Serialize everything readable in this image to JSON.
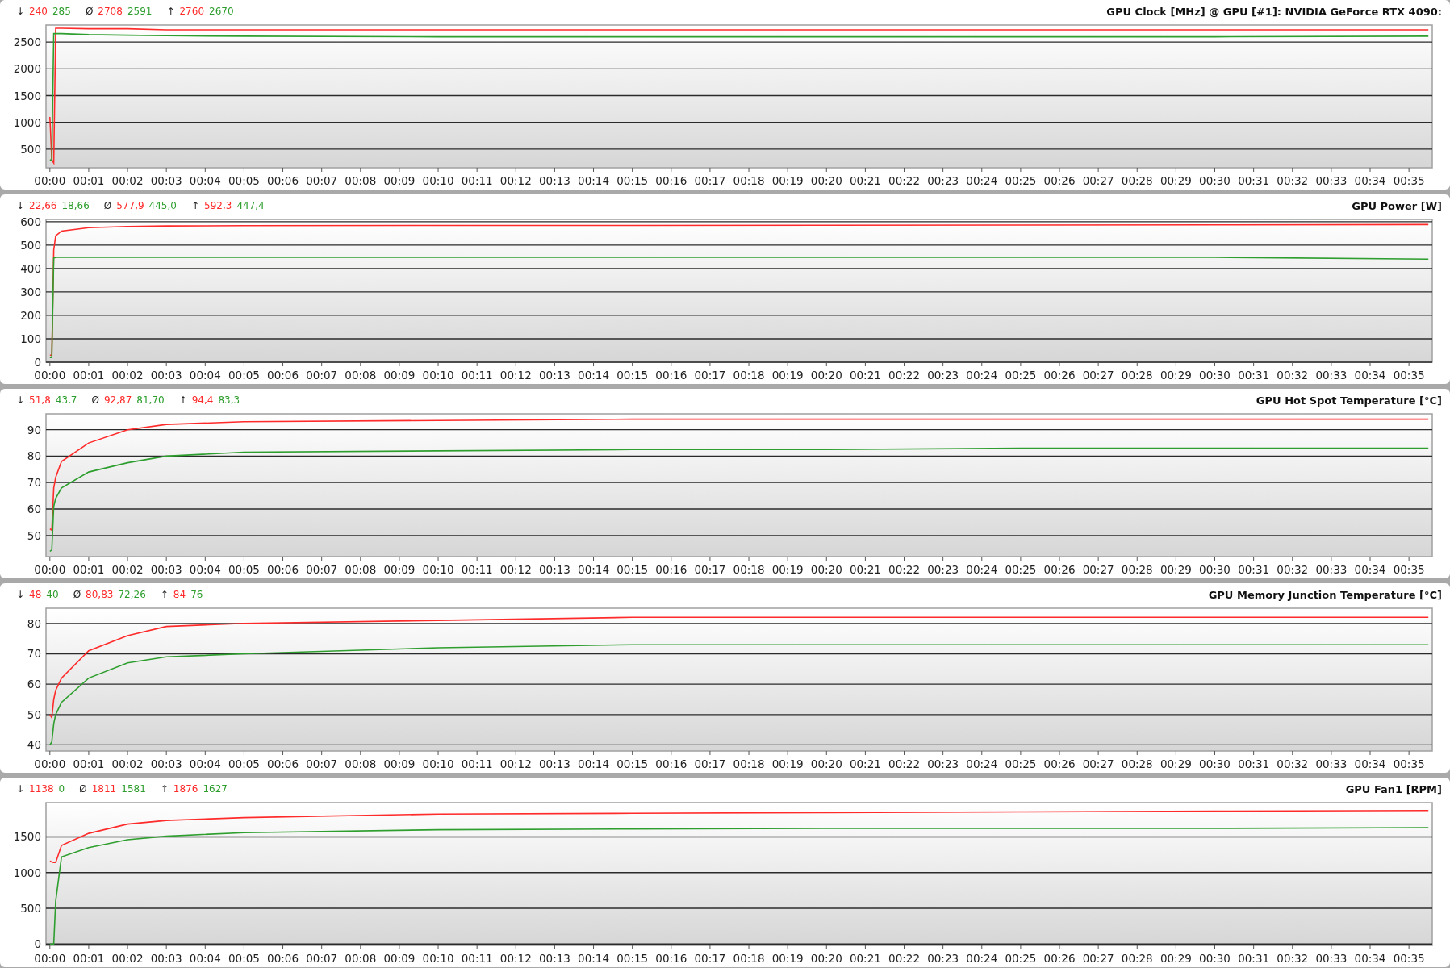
{
  "panels": [
    {
      "title": "GPU Clock [MHz] @ GPU [#1]: NVIDIA GeForce RTX 4090:",
      "stats": [
        {
          "symbol": "↓",
          "values": [
            "240",
            "285"
          ]
        },
        {
          "symbol": "Ø",
          "values": [
            "2708",
            "2591"
          ]
        },
        {
          "symbol": "↑",
          "values": [
            "2760",
            "2670"
          ]
        }
      ],
      "chart_data": {
        "type": "line",
        "x": [
          0,
          0.05,
          0.1,
          0.15,
          0.3,
          1,
          2,
          3,
          5,
          10,
          15,
          20,
          25,
          30,
          35.5
        ],
        "series": [
          {
            "color": "#ff2a2a",
            "values": [
              1100,
              300,
              240,
              2760,
              2760,
              2750,
              2750,
              2730,
              2730,
              2730,
              2730,
              2730,
              2730,
              2730,
              2730
            ]
          },
          {
            "color": "#2e9e2e",
            "values": [
              300,
              290,
              2660,
              2660,
              2660,
              2640,
              2630,
              2620,
              2610,
              2600,
              2600,
              2600,
              2600,
              2600,
              2610
            ]
          }
        ],
        "grid": true,
        "xlim": [
          -0.1,
          35.6
        ],
        "ylim": [
          150,
          2820
        ],
        "yticks": [
          500,
          1000,
          1500,
          2000,
          2500
        ],
        "xticks": [
          {
            "value": 0,
            "label": "00:00"
          },
          {
            "value": 1,
            "label": "00:01"
          },
          {
            "value": 2,
            "label": "00:02"
          },
          {
            "value": 3,
            "label": "00:03"
          },
          {
            "value": 4,
            "label": "00:04"
          },
          {
            "value": 5,
            "label": "00:05"
          },
          {
            "value": 6,
            "label": "00:06"
          },
          {
            "value": 7,
            "label": "00:07"
          },
          {
            "value": 8,
            "label": "00:08"
          },
          {
            "value": 9,
            "label": "00:09"
          },
          {
            "value": 10,
            "label": "00:10"
          },
          {
            "value": 11,
            "label": "00:11"
          },
          {
            "value": 12,
            "label": "00:12"
          },
          {
            "value": 13,
            "label": "00:13"
          },
          {
            "value": 14,
            "label": "00:14"
          },
          {
            "value": 15,
            "label": "00:15"
          },
          {
            "value": 16,
            "label": "00:16"
          },
          {
            "value": 17,
            "label": "00:17"
          },
          {
            "value": 18,
            "label": "00:18"
          },
          {
            "value": 19,
            "label": "00:19"
          },
          {
            "value": 20,
            "label": "00:20"
          },
          {
            "value": 21,
            "label": "00:21"
          },
          {
            "value": 22,
            "label": "00:22"
          },
          {
            "value": 23,
            "label": "00:23"
          },
          {
            "value": 24,
            "label": "00:24"
          },
          {
            "value": 25,
            "label": "00:25"
          },
          {
            "value": 26,
            "label": "00:26"
          },
          {
            "value": 27,
            "label": "00:27"
          },
          {
            "value": 28,
            "label": "00:28"
          },
          {
            "value": 29,
            "label": "00:29"
          },
          {
            "value": 30,
            "label": "00:30"
          },
          {
            "value": 31,
            "label": "00:31"
          },
          {
            "value": 32,
            "label": "00:32"
          },
          {
            "value": 33,
            "label": "00:33"
          },
          {
            "value": 34,
            "label": "00:34"
          },
          {
            "value": 35,
            "label": "00:35"
          }
        ]
      }
    },
    {
      "title": "GPU Power [W]",
      "stats": [
        {
          "symbol": "↓",
          "values": [
            "22,66",
            "18,66"
          ]
        },
        {
          "symbol": "Ø",
          "values": [
            "577,9",
            "445,0"
          ]
        },
        {
          "symbol": "↑",
          "values": [
            "592,3",
            "447,4"
          ]
        }
      ],
      "chart_data": {
        "type": "line",
        "x": [
          0,
          0.05,
          0.1,
          0.15,
          0.3,
          1,
          2,
          3,
          5,
          10,
          15,
          20,
          25,
          30,
          35.5
        ],
        "series": [
          {
            "color": "#ff2a2a",
            "values": [
              30,
              30,
              480,
              540,
              560,
              575,
              580,
              582,
              583,
              584,
              584,
              585,
              586,
              587,
              588
            ]
          },
          {
            "color": "#2e9e2e",
            "values": [
              20,
              20,
              445,
              448,
              448,
              448,
              448,
              448,
              448,
              448,
              448,
              448,
              448,
              448,
              440
            ]
          }
        ],
        "grid": true,
        "xlim": [
          -0.1,
          35.6
        ],
        "ylim": [
          0,
          610
        ],
        "yticks": [
          0,
          100,
          200,
          300,
          400,
          500,
          600
        ],
        "xticks": [
          {
            "value": 0,
            "label": "00:00"
          },
          {
            "value": 1,
            "label": "00:01"
          },
          {
            "value": 2,
            "label": "00:02"
          },
          {
            "value": 3,
            "label": "00:03"
          },
          {
            "value": 4,
            "label": "00:04"
          },
          {
            "value": 5,
            "label": "00:05"
          },
          {
            "value": 6,
            "label": "00:06"
          },
          {
            "value": 7,
            "label": "00:07"
          },
          {
            "value": 8,
            "label": "00:08"
          },
          {
            "value": 9,
            "label": "00:09"
          },
          {
            "value": 10,
            "label": "00:10"
          },
          {
            "value": 11,
            "label": "00:11"
          },
          {
            "value": 12,
            "label": "00:12"
          },
          {
            "value": 13,
            "label": "00:13"
          },
          {
            "value": 14,
            "label": "00:14"
          },
          {
            "value": 15,
            "label": "00:15"
          },
          {
            "value": 16,
            "label": "00:16"
          },
          {
            "value": 17,
            "label": "00:17"
          },
          {
            "value": 18,
            "label": "00:18"
          },
          {
            "value": 19,
            "label": "00:19"
          },
          {
            "value": 20,
            "label": "00:20"
          },
          {
            "value": 21,
            "label": "00:21"
          },
          {
            "value": 22,
            "label": "00:22"
          },
          {
            "value": 23,
            "label": "00:23"
          },
          {
            "value": 24,
            "label": "00:24"
          },
          {
            "value": 25,
            "label": "00:25"
          },
          {
            "value": 26,
            "label": "00:26"
          },
          {
            "value": 27,
            "label": "00:27"
          },
          {
            "value": 28,
            "label": "00:28"
          },
          {
            "value": 29,
            "label": "00:29"
          },
          {
            "value": 30,
            "label": "00:30"
          },
          {
            "value": 31,
            "label": "00:31"
          },
          {
            "value": 32,
            "label": "00:32"
          },
          {
            "value": 33,
            "label": "00:33"
          },
          {
            "value": 34,
            "label": "00:34"
          },
          {
            "value": 35,
            "label": "00:35"
          }
        ]
      }
    },
    {
      "title": "GPU Hot Spot Temperature [°C]",
      "stats": [
        {
          "symbol": "↓",
          "values": [
            "51,8",
            "43,7"
          ]
        },
        {
          "symbol": "Ø",
          "values": [
            "92,87",
            "81,70"
          ]
        },
        {
          "symbol": "↑",
          "values": [
            "94,4",
            "83,3"
          ]
        }
      ],
      "chart_data": {
        "type": "line",
        "x": [
          0,
          0.05,
          0.1,
          0.15,
          0.3,
          1,
          2,
          3,
          5,
          10,
          15,
          20,
          25,
          30,
          35.5
        ],
        "series": [
          {
            "color": "#ff2a2a",
            "values": [
              52.5,
              52,
              68,
              72,
              78,
              85,
              90,
              92,
              93,
              93.5,
              94,
              94,
              94,
              94,
              94
            ]
          },
          {
            "color": "#2e9e2e",
            "values": [
              44,
              44.5,
              61,
              64,
              68,
              74,
              77.5,
              80,
              81.5,
              82,
              82.5,
              82.5,
              83,
              83,
              83
            ]
          }
        ],
        "grid": true,
        "xlim": [
          -0.1,
          35.6
        ],
        "ylim": [
          42,
          96
        ],
        "yticks": [
          50,
          60,
          70,
          80,
          90
        ],
        "xticks": [
          {
            "value": 0,
            "label": "00:00"
          },
          {
            "value": 1,
            "label": "00:01"
          },
          {
            "value": 2,
            "label": "00:02"
          },
          {
            "value": 3,
            "label": "00:03"
          },
          {
            "value": 4,
            "label": "00:04"
          },
          {
            "value": 5,
            "label": "00:05"
          },
          {
            "value": 6,
            "label": "00:06"
          },
          {
            "value": 7,
            "label": "00:07"
          },
          {
            "value": 8,
            "label": "00:08"
          },
          {
            "value": 9,
            "label": "00:09"
          },
          {
            "value": 10,
            "label": "00:10"
          },
          {
            "value": 11,
            "label": "00:11"
          },
          {
            "value": 12,
            "label": "00:12"
          },
          {
            "value": 13,
            "label": "00:13"
          },
          {
            "value": 14,
            "label": "00:14"
          },
          {
            "value": 15,
            "label": "00:15"
          },
          {
            "value": 16,
            "label": "00:16"
          },
          {
            "value": 17,
            "label": "00:17"
          },
          {
            "value": 18,
            "label": "00:18"
          },
          {
            "value": 19,
            "label": "00:19"
          },
          {
            "value": 20,
            "label": "00:20"
          },
          {
            "value": 21,
            "label": "00:21"
          },
          {
            "value": 22,
            "label": "00:22"
          },
          {
            "value": 23,
            "label": "00:23"
          },
          {
            "value": 24,
            "label": "00:24"
          },
          {
            "value": 25,
            "label": "00:25"
          },
          {
            "value": 26,
            "label": "00:26"
          },
          {
            "value": 27,
            "label": "00:27"
          },
          {
            "value": 28,
            "label": "00:28"
          },
          {
            "value": 29,
            "label": "00:29"
          },
          {
            "value": 30,
            "label": "00:30"
          },
          {
            "value": 31,
            "label": "00:31"
          },
          {
            "value": 32,
            "label": "00:32"
          },
          {
            "value": 33,
            "label": "00:33"
          },
          {
            "value": 34,
            "label": "00:34"
          },
          {
            "value": 35,
            "label": "00:35"
          }
        ]
      }
    },
    {
      "title": "GPU Memory Junction Temperature [°C]",
      "stats": [
        {
          "symbol": "↓",
          "values": [
            "48",
            "40"
          ]
        },
        {
          "symbol": "Ø",
          "values": [
            "80,83",
            "72,26"
          ]
        },
        {
          "symbol": "↑",
          "values": [
            "84",
            "76"
          ]
        }
      ],
      "chart_data": {
        "type": "line",
        "x": [
          0,
          0.05,
          0.1,
          0.15,
          0.3,
          1,
          2,
          3,
          5,
          10,
          15,
          20,
          25,
          30,
          35.5
        ],
        "series": [
          {
            "color": "#ff2a2a",
            "values": [
              50,
              49,
              55,
              58,
              62,
              71,
              76,
              79,
              80,
              81,
              82,
              82,
              82,
              82,
              82
            ]
          },
          {
            "color": "#2e9e2e",
            "values": [
              40,
              41,
              47,
              50,
              54,
              62,
              67,
              69,
              70,
              72,
              73,
              73,
              73,
              73,
              73
            ]
          }
        ],
        "grid": true,
        "xlim": [
          -0.1,
          35.6
        ],
        "ylim": [
          38,
          85
        ],
        "yticks": [
          40,
          50,
          60,
          70,
          80
        ],
        "xticks": [
          {
            "value": 0,
            "label": "00:00"
          },
          {
            "value": 1,
            "label": "00:01"
          },
          {
            "value": 2,
            "label": "00:02"
          },
          {
            "value": 3,
            "label": "00:03"
          },
          {
            "value": 4,
            "label": "00:04"
          },
          {
            "value": 5,
            "label": "00:05"
          },
          {
            "value": 6,
            "label": "00:06"
          },
          {
            "value": 7,
            "label": "00:07"
          },
          {
            "value": 8,
            "label": "00:08"
          },
          {
            "value": 9,
            "label": "00:09"
          },
          {
            "value": 10,
            "label": "00:10"
          },
          {
            "value": 11,
            "label": "00:11"
          },
          {
            "value": 12,
            "label": "00:12"
          },
          {
            "value": 13,
            "label": "00:13"
          },
          {
            "value": 14,
            "label": "00:14"
          },
          {
            "value": 15,
            "label": "00:15"
          },
          {
            "value": 16,
            "label": "00:16"
          },
          {
            "value": 17,
            "label": "00:17"
          },
          {
            "value": 18,
            "label": "00:18"
          },
          {
            "value": 19,
            "label": "00:19"
          },
          {
            "value": 20,
            "label": "00:20"
          },
          {
            "value": 21,
            "label": "00:21"
          },
          {
            "value": 22,
            "label": "00:22"
          },
          {
            "value": 23,
            "label": "00:23"
          },
          {
            "value": 24,
            "label": "00:24"
          },
          {
            "value": 25,
            "label": "00:25"
          },
          {
            "value": 26,
            "label": "00:26"
          },
          {
            "value": 27,
            "label": "00:27"
          },
          {
            "value": 28,
            "label": "00:28"
          },
          {
            "value": 29,
            "label": "00:29"
          },
          {
            "value": 30,
            "label": "00:30"
          },
          {
            "value": 31,
            "label": "00:31"
          },
          {
            "value": 32,
            "label": "00:32"
          },
          {
            "value": 33,
            "label": "00:33"
          },
          {
            "value": 34,
            "label": "00:34"
          },
          {
            "value": 35,
            "label": "00:35"
          }
        ]
      }
    },
    {
      "title": "GPU Fan1 [RPM]",
      "stats": [
        {
          "symbol": "↓",
          "values": [
            "1138",
            "0"
          ]
        },
        {
          "symbol": "Ø",
          "values": [
            "1811",
            "1581"
          ]
        },
        {
          "symbol": "↑",
          "values": [
            "1876",
            "1627"
          ]
        }
      ],
      "chart_data": {
        "type": "line",
        "x": [
          0,
          0.05,
          0.1,
          0.15,
          0.3,
          1,
          2,
          3,
          5,
          10,
          15,
          20,
          25,
          30,
          35.5
        ],
        "series": [
          {
            "color": "#ff2a2a",
            "values": [
              1160,
              1150,
              1140,
              1140,
              1380,
              1550,
              1680,
              1730,
              1770,
              1820,
              1830,
              1840,
              1850,
              1860,
              1870
            ]
          },
          {
            "color": "#2e9e2e",
            "values": [
              0,
              0,
              0,
              600,
              1220,
              1350,
              1460,
              1510,
              1560,
              1600,
              1610,
              1620,
              1620,
              1620,
              1630
            ]
          }
        ],
        "grid": true,
        "xlim": [
          -0.1,
          35.6
        ],
        "ylim": [
          -20,
          1980
        ],
        "yticks": [
          0,
          500,
          1000,
          1500
        ],
        "xticks": [
          {
            "value": 0,
            "label": "00:00"
          },
          {
            "value": 1,
            "label": "00:01"
          },
          {
            "value": 2,
            "label": "00:02"
          },
          {
            "value": 3,
            "label": "00:03"
          },
          {
            "value": 4,
            "label": "00:04"
          },
          {
            "value": 5,
            "label": "00:05"
          },
          {
            "value": 6,
            "label": "00:06"
          },
          {
            "value": 7,
            "label": "00:07"
          },
          {
            "value": 8,
            "label": "00:08"
          },
          {
            "value": 9,
            "label": "00:09"
          },
          {
            "value": 10,
            "label": "00:10"
          },
          {
            "value": 11,
            "label": "00:11"
          },
          {
            "value": 12,
            "label": "00:12"
          },
          {
            "value": 13,
            "label": "00:13"
          },
          {
            "value": 14,
            "label": "00:14"
          },
          {
            "value": 15,
            "label": "00:15"
          },
          {
            "value": 16,
            "label": "00:16"
          },
          {
            "value": 17,
            "label": "00:17"
          },
          {
            "value": 18,
            "label": "00:18"
          },
          {
            "value": 19,
            "label": "00:19"
          },
          {
            "value": 20,
            "label": "00:20"
          },
          {
            "value": 21,
            "label": "00:21"
          },
          {
            "value": 22,
            "label": "00:22"
          },
          {
            "value": 23,
            "label": "00:23"
          },
          {
            "value": 24,
            "label": "00:24"
          },
          {
            "value": 25,
            "label": "00:25"
          },
          {
            "value": 26,
            "label": "00:26"
          },
          {
            "value": 27,
            "label": "00:27"
          },
          {
            "value": 28,
            "label": "00:28"
          },
          {
            "value": 29,
            "label": "00:29"
          },
          {
            "value": 30,
            "label": "00:30"
          },
          {
            "value": 31,
            "label": "00:31"
          },
          {
            "value": 32,
            "label": "00:32"
          },
          {
            "value": 33,
            "label": "00:33"
          },
          {
            "value": 34,
            "label": "00:34"
          },
          {
            "value": 35,
            "label": "00:35"
          }
        ]
      }
    }
  ]
}
